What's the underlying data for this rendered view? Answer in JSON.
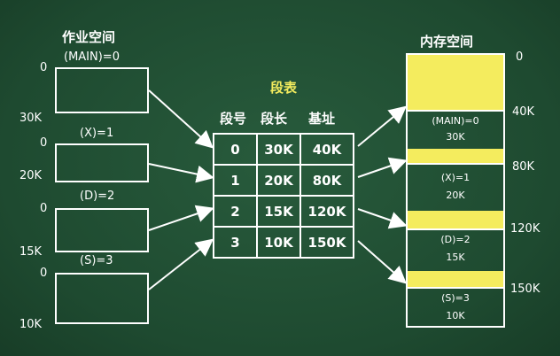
{
  "job_space": {
    "title": "作业空间",
    "segments": [
      {
        "label": "(MAIN)=0",
        "start": "0",
        "end": "30K"
      },
      {
        "label": "(X)=1",
        "start": "0",
        "end": "20K"
      },
      {
        "label": "(D)=2",
        "start": "0",
        "end": "15K"
      },
      {
        "label": "(S)=3",
        "start": "0",
        "end": "10K"
      }
    ]
  },
  "segment_table": {
    "title": "段表",
    "headers": [
      "段号",
      "段长",
      "基址"
    ],
    "rows": [
      [
        "0",
        "30K",
        "40K"
      ],
      [
        "1",
        "20K",
        "80K"
      ],
      [
        "2",
        "15K",
        "120K"
      ],
      [
        "3",
        "10K",
        "150K"
      ]
    ]
  },
  "memory_space": {
    "title": "内存空间",
    "addresses": [
      "0",
      "40K",
      "80K",
      "120K",
      "150K"
    ],
    "blocks": [
      {
        "name": "(MAIN)=0",
        "size": "30K"
      },
      {
        "name": "(X)=1",
        "size": "20K"
      },
      {
        "name": "(D)=2",
        "size": "15K"
      },
      {
        "name": "(S)=3",
        "size": "10K"
      }
    ]
  },
  "colors": {
    "board": "#1f4a30",
    "chalk": "#ffffff",
    "highlight": "#f4ec5e"
  }
}
